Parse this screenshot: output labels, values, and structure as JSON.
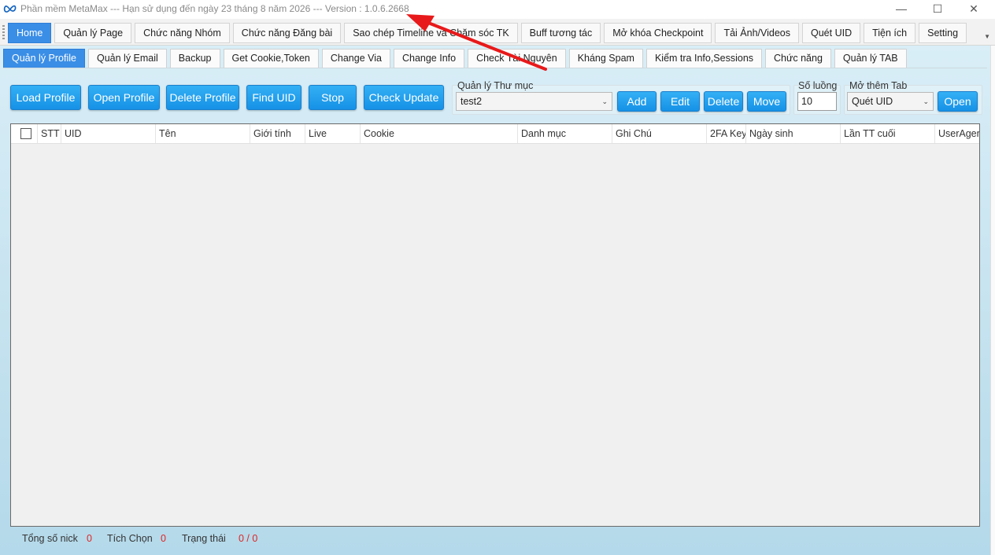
{
  "window": {
    "title": "Phần mềm MetaMax --- Hạn sử dụng đến ngày 23 tháng 8 năm 2026 --- Version : 1.0.6.2668",
    "minimize": "—",
    "maximize": "☐",
    "close": "✕"
  },
  "menu_tabs": [
    "Home",
    "Quản lý Page",
    "Chức năng Nhóm",
    "Chức năng Đăng bài",
    "Sao chép Timeline và Chăm sóc TK",
    "Buff tương tác",
    "Mở khóa Checkpoint",
    "Tải Ảnh/Videos",
    "Quét UID",
    "Tiện ích",
    "Setting"
  ],
  "sub_tabs": [
    "Quản lý Profile",
    "Quản lý Email",
    "Backup",
    "Get Cookie,Token",
    "Change Via",
    "Change Info",
    "Check Tài Nguyên",
    "Kháng Spam",
    "Kiểm tra Info,Sessions",
    "Chức năng",
    "Quản lý TAB"
  ],
  "toolbar": {
    "load_profile": "Load Profile",
    "open_profile": "Open Profile",
    "delete_profile": "Delete Profile",
    "find_uid": "Find UID",
    "stop": "Stop",
    "check_update": "Check Update"
  },
  "folder": {
    "label": "Quản lý Thư mục",
    "selected": "test2",
    "add": "Add",
    "edit": "Edit",
    "delete": "Delete",
    "move": "Move"
  },
  "threads": {
    "label": "Số luồng",
    "value": "10"
  },
  "open_tab": {
    "label": "Mở thêm Tab",
    "selected": "Quét UID",
    "open": "Open"
  },
  "grid": {
    "columns": [
      "STT",
      "UID",
      "Tên",
      "Giới tính",
      "Live",
      "Cookie",
      "Danh mục",
      "Ghi Chú",
      "2FA Key",
      "Ngày sinh",
      "Lần TT cuối",
      "UserAgent"
    ],
    "rows": []
  },
  "status_bar": {
    "total_label": "Tổng số nick",
    "total_value": "0",
    "selected_label": "Tích Chọn",
    "selected_value": "0",
    "state_label": "Trạng thái",
    "state_value": "0 / 0"
  },
  "colors": {
    "accent": "#3a8ee6",
    "button": "#1691e6",
    "annotation_arrow": "#e8191a",
    "status_value": "#e02424"
  }
}
